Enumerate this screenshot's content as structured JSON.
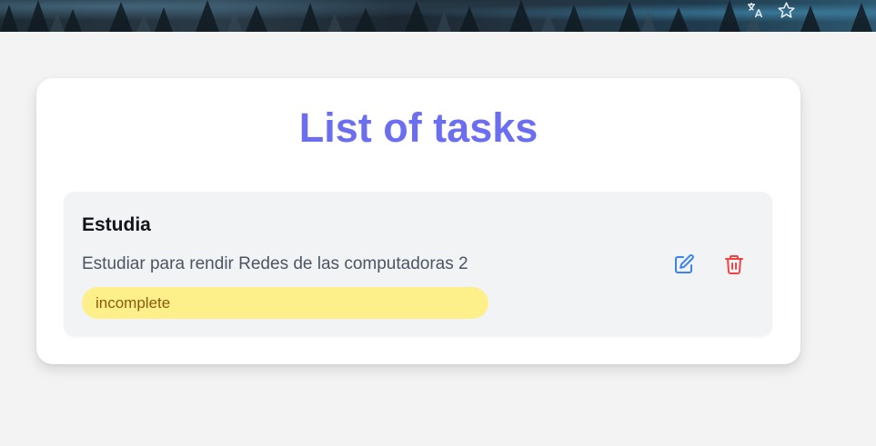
{
  "banner": {
    "icons": [
      "translate-icon",
      "star-icon"
    ],
    "icon_color": "#e8eef2"
  },
  "main": {
    "title": "List of tasks",
    "title_color": "#6c6ef0",
    "tasks": [
      {
        "title": "Estudia",
        "description": "Estudiar para rendir Redes de las computadoras 2",
        "status": "incomplete",
        "status_bg": "#fdf08a",
        "status_text_color": "#8a5a0a",
        "actions": [
          "edit-icon",
          "trash-icon"
        ],
        "edit_color": "#3b82f6",
        "delete_color": "#ef4444"
      }
    ]
  }
}
